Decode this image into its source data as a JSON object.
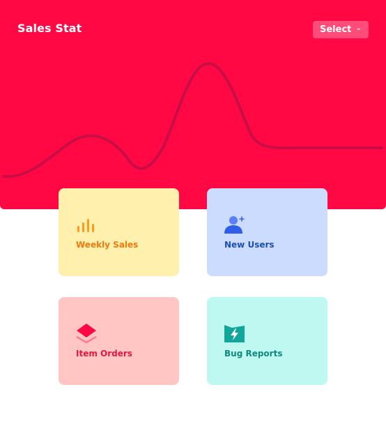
{
  "header": {
    "title": "Sales Stat",
    "select_label": "Select"
  },
  "colors": {
    "hero": "#ff0844",
    "line": "#c90d46"
  },
  "cards": [
    {
      "label": "Weekly Sales",
      "icon": "bar-chart-icon",
      "color": "#f07a0c"
    },
    {
      "label": "New Users",
      "icon": "add-user-icon",
      "color": "#1b4fb8"
    },
    {
      "label": "Item Orders",
      "icon": "layers-icon",
      "color": "#e4183c"
    },
    {
      "label": "Bug Reports",
      "icon": "bolt-box-icon",
      "color": "#0f8a7e"
    }
  ]
}
